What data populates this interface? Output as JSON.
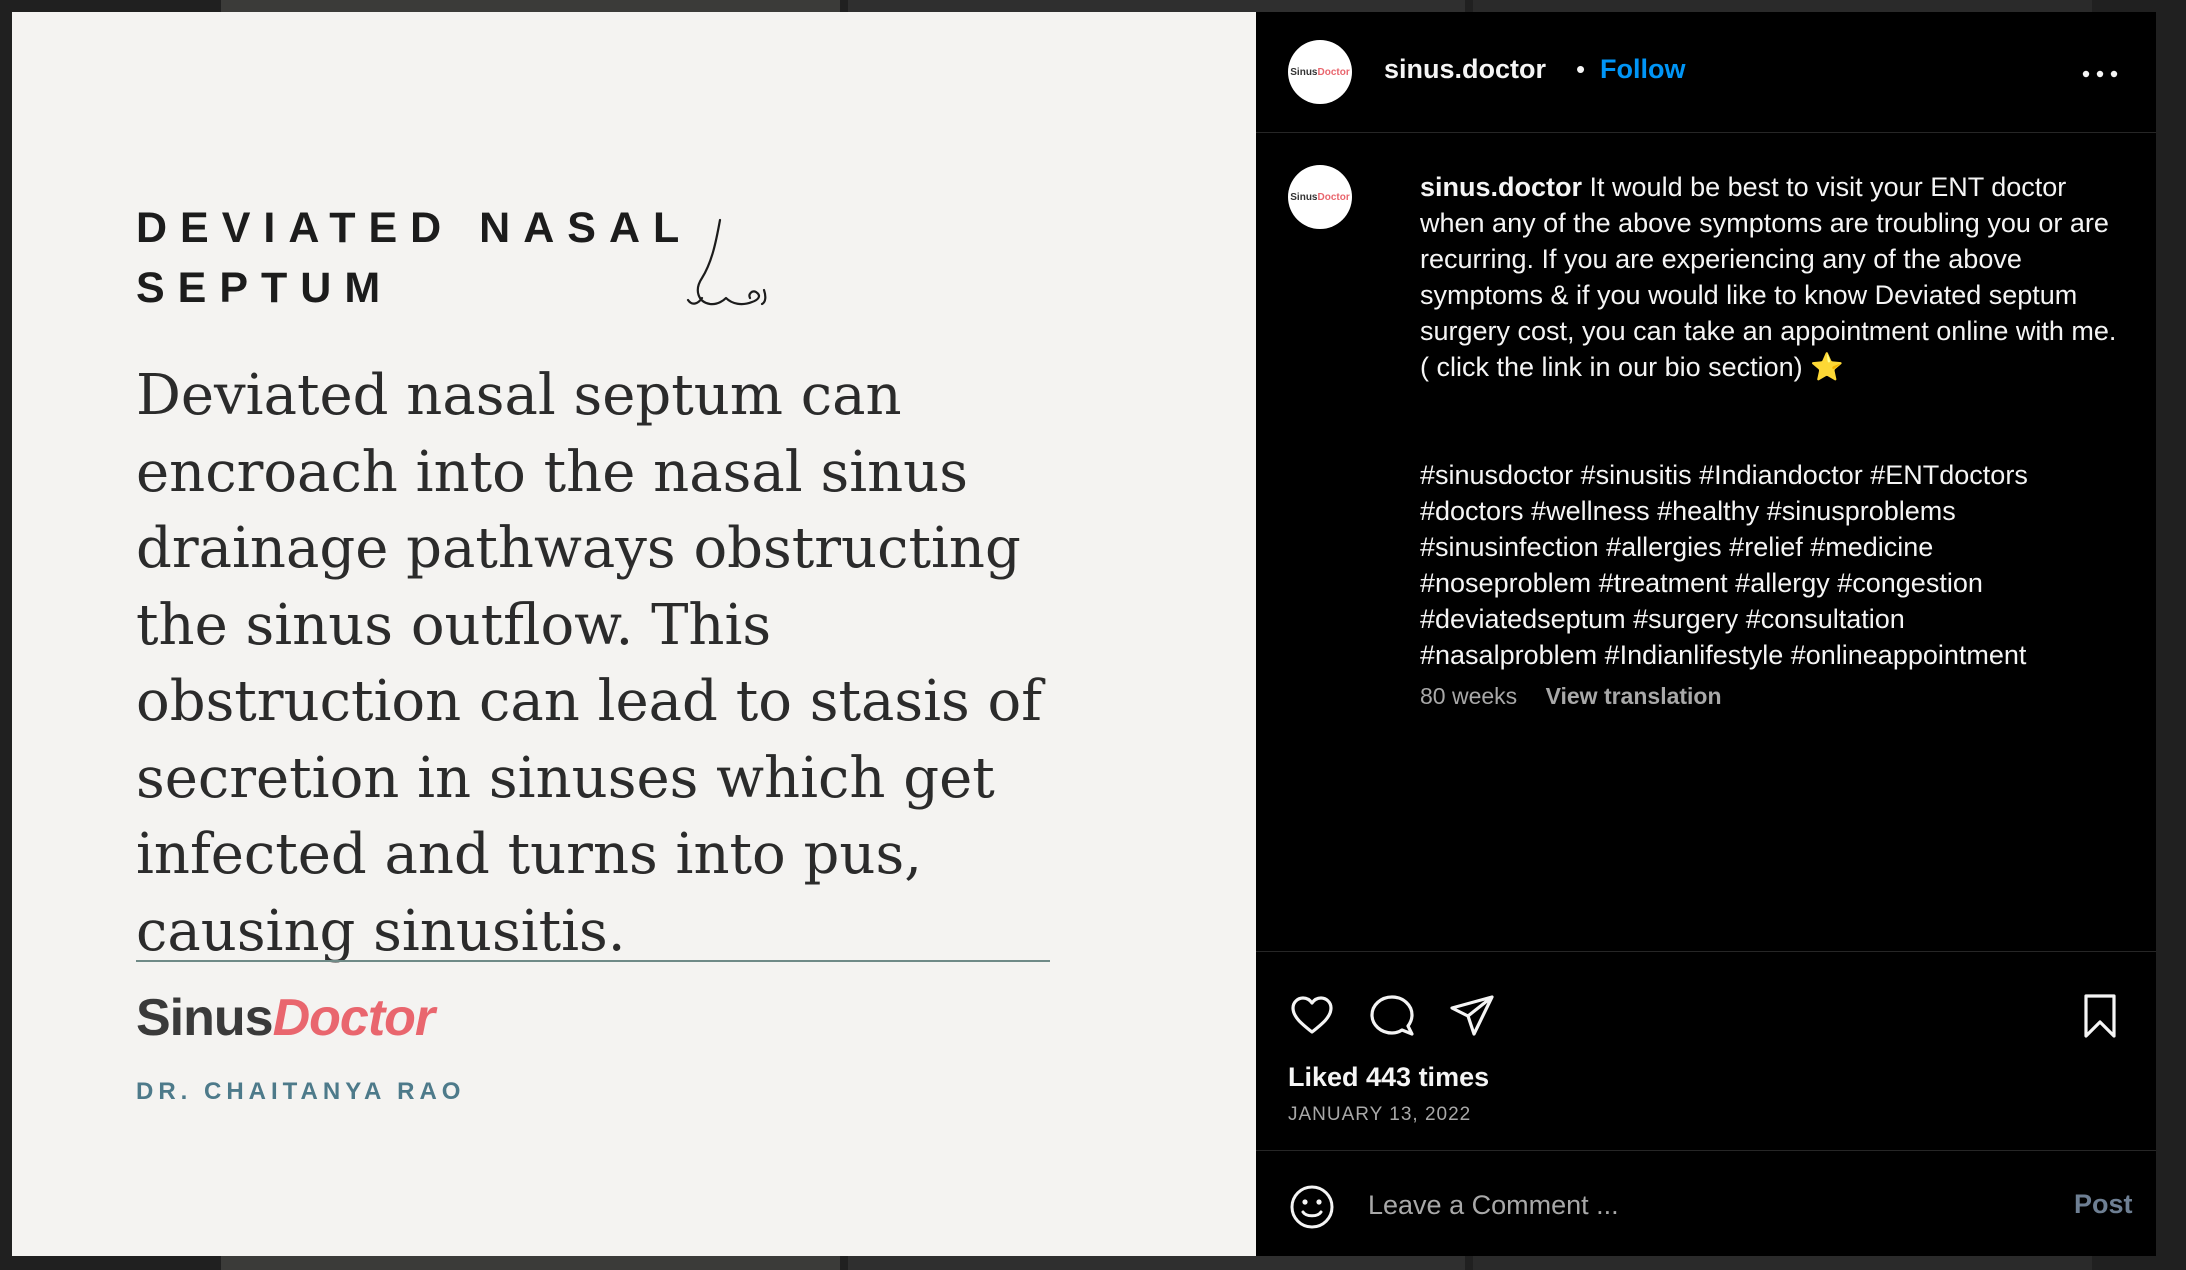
{
  "post_image": {
    "heading": "DEVIATED NASAL\nSEPTUM",
    "body": "Deviated nasal septum can encroach into the nasal sinus drainage pathways obstructing the sinus outflow. This obstruction can lead to stasis of secretion in sinuses which get infected and turns into pus, causing sinusitis.",
    "logo_part1": "Sinus",
    "logo_part2": "Doctor",
    "doctor_name": "DR. CHAITANYA RAO"
  },
  "header": {
    "username": "sinus.doctor",
    "separator": "•",
    "follow_label": "Follow"
  },
  "caption": {
    "username": "sinus.doctor",
    "text": "It would be best to visit your ENT doctor when any of the above symptoms are troubling you or are recurring. If you are experiencing any of the above symptoms & if you would like to know Deviated septum surgery cost, you can take an appointment online with me. ( click the link in our bio section) ⭐",
    "hashtags": "#sinusdoctor #sinusitis #Indiandoctor #ENTdoctors\n#doctors #wellness #healthy #sinusproblems\n#sinusinfection #allergies #relief #medicine\n#noseproblem #treatment #allergy #congestion\n#deviatedseptum #surgery #consultation\n#nasalproblem #Indianlifestyle #onlineappointment",
    "time": "80 weeks",
    "view_translation": "View translation"
  },
  "actions": {
    "likes": "Liked 443 times",
    "date": "JANUARY 13, 2022",
    "icons": [
      "heart-icon",
      "comment-icon",
      "share-icon",
      "bookmark-icon"
    ]
  },
  "comment": {
    "placeholder": "Leave a Comment ...",
    "post_label": "Post"
  },
  "colors": {
    "follow": "#0095f6",
    "logo_accent": "#e9666e",
    "doctor_name": "#4d7a8a",
    "panel_bg": "#000000",
    "image_bg": "#f4f3f1"
  }
}
